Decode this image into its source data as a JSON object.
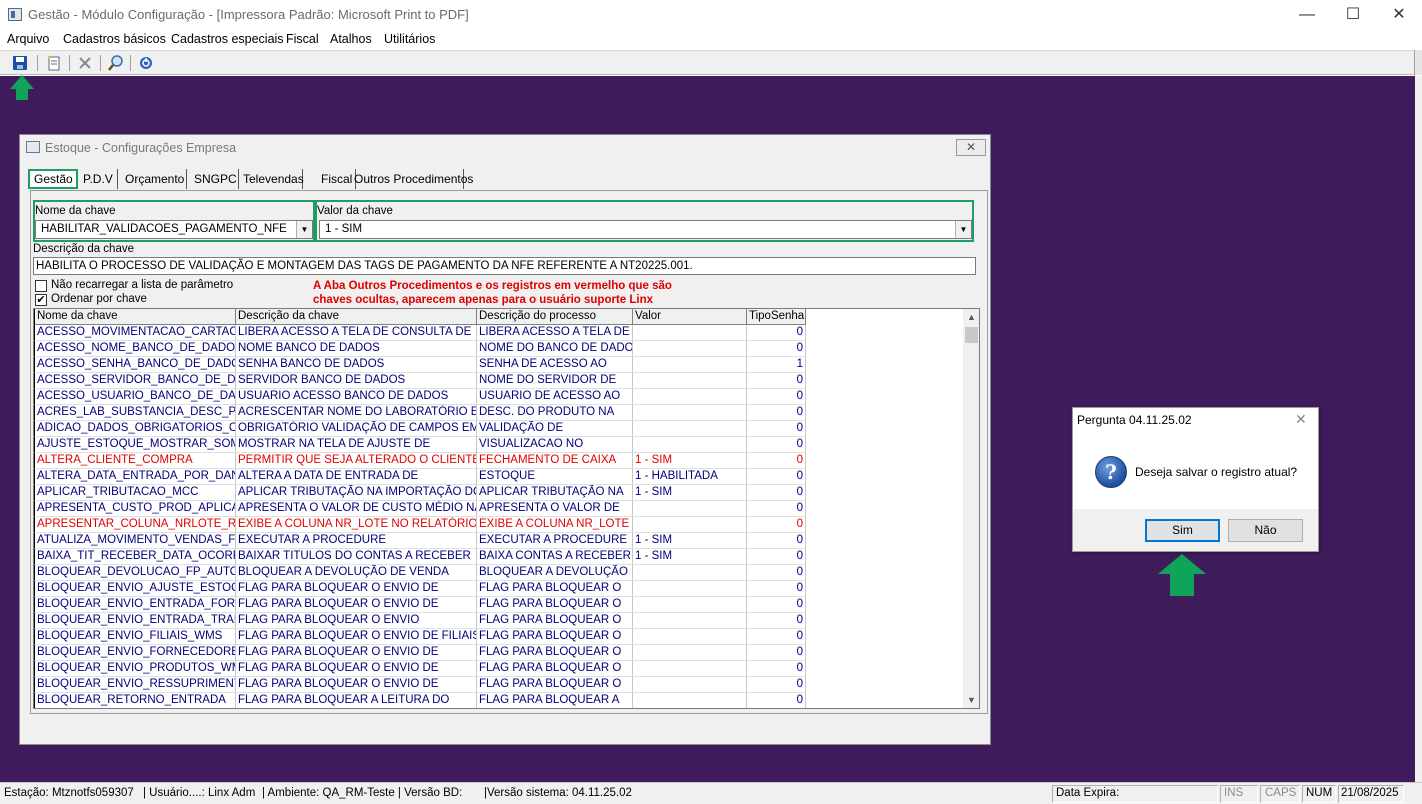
{
  "window": {
    "title": "Gestão - Módulo Configuração - [Impressora Padrão: Microsoft Print to PDF]",
    "minimize": "—",
    "maximize": "☐",
    "close": "✕"
  },
  "menu": [
    "Arquivo",
    "Cadastros básicos",
    "Cadastros especiais",
    "Fiscal",
    "Atalhos",
    "Utilitários"
  ],
  "toolbar_icons": [
    "save-icon",
    "new-icon",
    "delete-icon",
    "search-icon",
    "exit-icon"
  ],
  "child": {
    "title": "Estoque - Configurações Empresa",
    "close": "✕",
    "tabs": [
      "Gestão",
      "P.D.V",
      "Orçamento",
      "SNGPC",
      "Televendas",
      "Fiscal",
      "Outros Procedimentos"
    ],
    "active_tab": "Gestão",
    "key_name_label": "Nome da chave",
    "key_name_value": "HABILITAR_VALIDACOES_PAGAMENTO_NFE",
    "key_value_label": "Valor da chave",
    "key_value_value": "1 - SIM",
    "description_label": "Descrição da chave",
    "description_value": "HABILITA O PROCESSO DE VALIDAÇÃO E MONTAGEM DAS TAGS DE PAGAMENTO DA NFE REFERENTE A NT20225.001.",
    "no_reload_label": "Não recarregar a lista de parâmetro",
    "no_reload_checked": false,
    "sort_label": "Ordenar por chave",
    "sort_checked": true,
    "check_mark": "✔",
    "annotation_line1": "A Aba Outros Procedimentos e os registros em vermelho que são",
    "annotation_line2": "chaves ocultas, aparecem apenas para o usuário suporte Linx"
  },
  "grid": {
    "columns": [
      "Nome da chave",
      "Descrição  da chave",
      "Descrição do processo",
      "Valor",
      "TipoSenha"
    ],
    "rows": [
      {
        "name": "ACESSO_MOVIMENTACAO_CARTAO_M",
        "desc": "LIBERA ACESSO A TELA DE CONSULTA DE",
        "proc": "LIBERA ACESSO A TELA DE",
        "valor": "",
        "tipo": "0",
        "red": false
      },
      {
        "name": "ACESSO_NOME_BANCO_DE_DADOS",
        "desc": "NOME BANCO DE DADOS",
        "proc": "NOME DO BANCO DE DADOS",
        "valor": "",
        "tipo": "0",
        "red": false
      },
      {
        "name": "ACESSO_SENHA_BANCO_DE_DADOS",
        "desc": "SENHA BANCO DE DADOS",
        "proc": "SENHA DE ACESSO AO",
        "valor": "",
        "tipo": "1",
        "red": false
      },
      {
        "name": "ACESSO_SERVIDOR_BANCO_DE_DAD",
        "desc": "SERVIDOR BANCO DE DADOS",
        "proc": "NOME DO SERVIDOR DE",
        "valor": "",
        "tipo": "0",
        "red": false
      },
      {
        "name": "ACESSO_USUARIO_BANCO_DE_DADO",
        "desc": "USUARIO ACESSO BANCO DE DADOS",
        "proc": "USUARIO DE ACESSO AO",
        "valor": "",
        "tipo": "0",
        "red": false
      },
      {
        "name": "ACRES_LAB_SUBSTANCIA_DESC_PRO",
        "desc": "ACRESCENTAR NOME DO LABORATÓRIO E",
        "proc": "DESC. DO PRODUTO NA",
        "valor": "",
        "tipo": "0",
        "red": false
      },
      {
        "name": "ADICAO_DADOS_OBRIGATORIOS_CAD",
        "desc": "OBRIGATÓRIO VALIDAÇÃO DE CAMPOS EM",
        "proc": " VALIDAÇÃO DE",
        "valor": "",
        "tipo": "0",
        "red": false
      },
      {
        "name": "AJUSTE_ESTOQUE_MOSTRAR_SOME",
        "desc": "MOSTRAR NA TELA DE AJUSTE DE",
        "proc": "VISUALIZACAO NO",
        "valor": "",
        "tipo": "0",
        "red": false
      },
      {
        "name": "ALTERA_CLIENTE_COMPRA",
        "desc": "PERMITIR QUE SEJA ALTERADO O CLIENTE",
        "proc": "FECHAMENTO DE CAIXA",
        "valor": "1 - SIM",
        "tipo": "0",
        "red": true
      },
      {
        "name": "ALTERA_DATA_ENTRADA_POR_DANF",
        "desc": "ALTERA A DATA DE ENTRADA DE",
        "proc": "ESTOQUE",
        "valor": "1 - HABILITADA",
        "tipo": "0",
        "red": false
      },
      {
        "name": "APLICAR_TRIBUTACAO_MCC",
        "desc": "APLICAR TRIBUTAÇÃO NA IMPORTAÇÃO DO",
        "proc": "APLICAR TRIBUTAÇÃO NA",
        "valor": "1 - SIM",
        "tipo": "0",
        "red": false
      },
      {
        "name": "APRESENTA_CUSTO_PROD_APLICAC",
        "desc": "APRESENTA O VALOR DE CUSTO MÉDIO NA",
        "proc": "APRESENTA O VALOR DE",
        "valor": "",
        "tipo": "0",
        "red": false
      },
      {
        "name": "APRESENTAR_COLUNA_NRLOTE_REL",
        "desc": "EXIBE A COLUNA NR_LOTE NO RELATÓRIO",
        "proc": "EXIBE A COLUNA NR_LOTE",
        "valor": "",
        "tipo": "0",
        "red": true
      },
      {
        "name": "ATUALIZA_MOVIMENTO_VENDAS_FEC",
        "desc": "EXECUTAR A PROCEDURE",
        "proc": "EXECUTAR A PROCEDURE",
        "valor": "1 - SIM",
        "tipo": "0",
        "red": false
      },
      {
        "name": "BAIXA_TIT_RECEBER_DATA_OCORRE",
        "desc": "BAIXAR TITULOS DO CONTAS A RECEBER",
        "proc": "BAIXA CONTAS A RECEBER -",
        "valor": "1 - SIM",
        "tipo": "0",
        "red": false
      },
      {
        "name": "BLOQUEAR_DEVOLUCAO_FP_AUTORI",
        "desc": "BLOQUEAR A DEVOLUÇÃO DE VENDA",
        "proc": "BLOQUEAR A DEVOLUÇÃO",
        "valor": "",
        "tipo": "0",
        "red": false
      },
      {
        "name": "BLOQUEAR_ENVIO_AJUSTE_ESTOQU",
        "desc": "FLAG PARA BLOQUEAR O ENVIO DE",
        "proc": "FLAG PARA BLOQUEAR O",
        "valor": "",
        "tipo": "0",
        "red": false
      },
      {
        "name": "BLOQUEAR_ENVIO_ENTRADA_FORNE",
        "desc": "FLAG PARA BLOQUEAR O ENVIO DE",
        "proc": "FLAG PARA BLOQUEAR O",
        "valor": "",
        "tipo": "0",
        "red": false
      },
      {
        "name": "BLOQUEAR_ENVIO_ENTRADA_TRANS",
        "desc": "FLAG PARA BLOQUEAR O ENVIO",
        "proc": "FLAG PARA BLOQUEAR O",
        "valor": "",
        "tipo": "0",
        "red": false
      },
      {
        "name": "BLOQUEAR_ENVIO_FILIAIS_WMS",
        "desc": "FLAG PARA BLOQUEAR O ENVIO DE FILIAIS",
        "proc": "FLAG PARA BLOQUEAR O",
        "valor": "",
        "tipo": "0",
        "red": false
      },
      {
        "name": "BLOQUEAR_ENVIO_FORNECEDORES_",
        "desc": "FLAG PARA BLOQUEAR O ENVIO DE",
        "proc": "FLAG PARA BLOQUEAR O",
        "valor": "",
        "tipo": "0",
        "red": false
      },
      {
        "name": "BLOQUEAR_ENVIO_PRODUTOS_WMS",
        "desc": "FLAG PARA BLOQUEAR O ENVIO DE",
        "proc": "FLAG PARA BLOQUEAR O",
        "valor": "",
        "tipo": "0",
        "red": false
      },
      {
        "name": "BLOQUEAR_ENVIO_RESSUPRIMENTO",
        "desc": "FLAG PARA BLOQUEAR O ENVIO DE",
        "proc": "FLAG PARA BLOQUEAR O",
        "valor": "",
        "tipo": "0",
        "red": false
      },
      {
        "name": "BLOQUEAR_RETORNO_ENTRADA",
        "desc": "FLAG PARA BLOQUEAR A LEITURA DO",
        "proc": "FLAG PARA BLOQUEAR A",
        "valor": "",
        "tipo": "0",
        "red": false
      }
    ]
  },
  "dialog": {
    "title": "Pergunta 04.11.25.02",
    "close": "✕",
    "icon": "question-icon",
    "icon_glyph": "?",
    "message": "Deseja salvar o registro atual?",
    "yes": "Sim",
    "no": "Não"
  },
  "status": {
    "estacao": "Estação: Mtznotfs059307",
    "usuario": "| Usuário....: Linx Adm",
    "ambiente": "| Ambiente: QA_RM-Teste | Versão BD:",
    "versao": "|Versão sistema: 04.11.25.02",
    "data_expira": "Data Expira:",
    "ins": "INS",
    "caps": "CAPS",
    "num": "NUM",
    "date": "21/08/2025"
  },
  "colors": {
    "mdi_background": "#3f1b5c",
    "highlight_green": "#1e9e62",
    "hidden_key_red": "#e00000",
    "key_text_blue": "#00007a"
  }
}
